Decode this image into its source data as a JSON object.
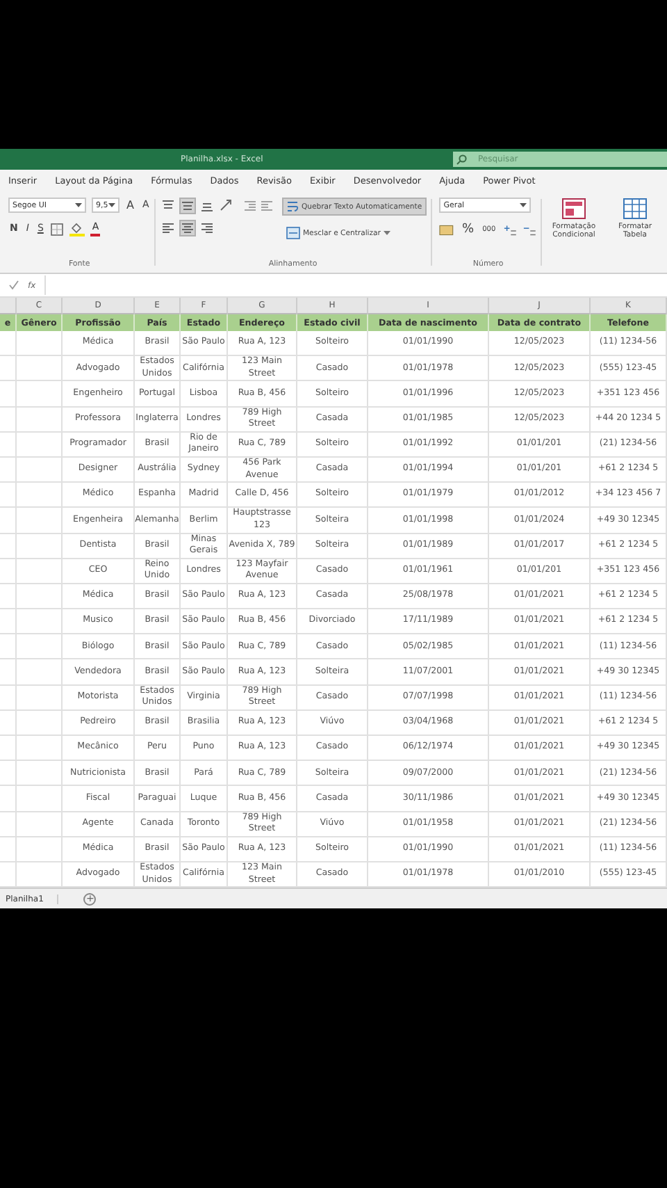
{
  "window": {
    "title": "Planilha.xlsx - Excel",
    "search": {
      "placeholder": "Pesquisar"
    }
  },
  "ribbon_tabs": [
    "Inserir",
    "Layout da Página",
    "Fórmulas",
    "Dados",
    "Revisão",
    "Exibir",
    "Desenvolvedor",
    "Ajuda",
    "Power Pivot"
  ],
  "font_group": {
    "label": "Fonte",
    "font": "Segoe UI",
    "size": "9,5",
    "grow": "A",
    "shrink": "A",
    "bold": "N",
    "italic": "I",
    "underline": "S",
    "color_letter": "A"
  },
  "alignment_group": {
    "label": "Alinhamento",
    "buttons": [
      {
        "kind": "top",
        "on": false
      },
      {
        "kind": "middle",
        "on": true
      },
      {
        "kind": "bottom",
        "on": false
      },
      {
        "kind": "left",
        "on": false
      },
      {
        "kind": "center",
        "on": true
      },
      {
        "kind": "right",
        "on": false
      }
    ],
    "wrap": {
      "label": "Quebrar Texto Automaticamente",
      "on": true
    },
    "merge": {
      "label": "Mesclar e Centralizar",
      "on": false
    }
  },
  "number_group": {
    "label": "Número",
    "format": "Geral",
    "percent": "%",
    "thousands": "000"
  },
  "styles_group": [
    {
      "label": "Formatação Condicional"
    },
    {
      "label": "Formatar Tabela"
    }
  ],
  "formula_bar": {
    "fx": "fx"
  },
  "column_letters": [
    "C",
    "D",
    "E",
    "F",
    "G",
    "H",
    "I",
    "J",
    "K"
  ],
  "header_row": [
    "e",
    "Gênero",
    "Profissão",
    "País",
    "Estado",
    "Endereço",
    "Estado civil",
    "Data de nascimento",
    "Data de contrato",
    "Telefone"
  ],
  "rows": [
    {
      "profissao": "Médica",
      "pais": "Brasil",
      "estado": "São Paulo",
      "endereco": "Rua A, 123",
      "estado_civil": "Solteiro",
      "nascimento": "01/01/1990",
      "contrato": "12/05/2023",
      "telefone": "(11) 1234-56"
    },
    {
      "profissao": "Advogado",
      "pais": "Estados Unidos",
      "estado": "Califórnia",
      "endereco": "123 Main Street",
      "estado_civil": "Casado",
      "nascimento": "01/01/1978",
      "contrato": "12/05/2023",
      "telefone": "(555) 123-45"
    },
    {
      "profissao": "Engenheiro",
      "pais": "Portugal",
      "estado": "Lisboa",
      "endereco": "Rua B, 456",
      "estado_civil": "Solteiro",
      "nascimento": "01/01/1996",
      "contrato": "12/05/2023",
      "telefone": "+351 123 456"
    },
    {
      "profissao": "Professora",
      "pais": "Inglaterra",
      "estado": "Londres",
      "endereco": "789 High Street",
      "estado_civil": "Casada",
      "nascimento": "01/01/1985",
      "contrato": "12/05/2023",
      "telefone": "+44 20 1234 5"
    },
    {
      "profissao": "Programador",
      "pais": "Brasil",
      "estado": "Rio de Janeiro",
      "endereco": "Rua C, 789",
      "estado_civil": "Solteiro",
      "nascimento": "01/01/1992",
      "contrato": "01/01/201",
      "telefone": "(21) 1234-56"
    },
    {
      "profissao": "Designer",
      "pais": "Austrália",
      "estado": "Sydney",
      "endereco": "456 Park Avenue",
      "estado_civil": "Casada",
      "nascimento": "01/01/1994",
      "contrato": "01/01/201",
      "telefone": "+61 2 1234 5"
    },
    {
      "profissao": "Médico",
      "pais": "Espanha",
      "estado": "Madrid",
      "endereco": "Calle D, 456",
      "estado_civil": "Solteiro",
      "nascimento": "01/01/1979",
      "contrato": "01/01/2012",
      "telefone": "+34 123 456 7"
    },
    {
      "profissao": "Engenheira",
      "pais": "Alemanha",
      "estado": "Berlim",
      "endereco": "Hauptstrasse 123",
      "estado_civil": "Solteira",
      "nascimento": "01/01/1998",
      "contrato": "01/01/2024",
      "telefone": "+49 30 12345"
    },
    {
      "profissao": "Dentista",
      "pais": "Brasil",
      "estado": "Minas Gerais",
      "endereco": "Avenida X, 789",
      "estado_civil": "Solteira",
      "nascimento": "01/01/1989",
      "contrato": "01/01/2017",
      "telefone": "+61 2 1234 5"
    },
    {
      "profissao": "CEO",
      "pais": "Reino Unido",
      "estado": "Londres",
      "endereco": "123 Mayfair Avenue",
      "estado_civil": "Casado",
      "nascimento": "01/01/1961",
      "contrato": "01/01/201",
      "telefone": "+351 123 456"
    },
    {
      "profissao": "Médica",
      "pais": "Brasil",
      "estado": "São Paulo",
      "endereco": "Rua A, 123",
      "estado_civil": "Casada",
      "nascimento": "25/08/1978",
      "contrato": "01/01/2021",
      "telefone": "+61 2 1234 5"
    },
    {
      "profissao": "Musico",
      "pais": "Brasil",
      "estado": "São Paulo",
      "endereco": "Rua B, 456",
      "estado_civil": "Divorciado",
      "nascimento": "17/11/1989",
      "contrato": "01/01/2021",
      "telefone": "+61 2 1234 5"
    },
    {
      "profissao": "Biólogo",
      "pais": "Brasil",
      "estado": "São Paulo",
      "endereco": "Rua C, 789",
      "estado_civil": "Casado",
      "nascimento": "05/02/1985",
      "contrato": "01/01/2021",
      "telefone": "(11) 1234-56"
    },
    {
      "profissao": "Vendedora",
      "pais": "Brasil",
      "estado": "São Paulo",
      "endereco": "Rua A, 123",
      "estado_civil": "Solteira",
      "nascimento": "11/07/2001",
      "contrato": "01/01/2021",
      "telefone": "+49 30 12345"
    },
    {
      "profissao": "Motorista",
      "pais": "Estados Unidos",
      "estado": "Virginia",
      "endereco": "789 High Street",
      "estado_civil": "Casado",
      "nascimento": "07/07/1998",
      "contrato": "01/01/2021",
      "telefone": "(11) 1234-56"
    },
    {
      "profissao": "Pedreiro",
      "pais": "Brasil",
      "estado": "Brasilia",
      "endereco": "Rua A, 123",
      "estado_civil": "Viúvo",
      "nascimento": "03/04/1968",
      "contrato": "01/01/2021",
      "telefone": "+61 2 1234 5"
    },
    {
      "profissao": "Mecânico",
      "pais": "Peru",
      "estado": "Puno",
      "endereco": "Rua A, 123",
      "estado_civil": "Casado",
      "nascimento": "06/12/1974",
      "contrato": "01/01/2021",
      "telefone": "+49 30 12345"
    },
    {
      "profissao": "Nutricionista",
      "pais": "Brasil",
      "estado": "Pará",
      "endereco": "Rua C, 789",
      "estado_civil": "Solteira",
      "nascimento": "09/07/2000",
      "contrato": "01/01/2021",
      "telefone": "(21) 1234-56"
    },
    {
      "profissao": "Fiscal",
      "pais": "Paraguai",
      "estado": "Luque",
      "endereco": "Rua B, 456",
      "estado_civil": "Casada",
      "nascimento": "30/11/1986",
      "contrato": "01/01/2021",
      "telefone": "+49 30 12345"
    },
    {
      "profissao": "Agente",
      "pais": "Canada",
      "estado": "Toronto",
      "endereco": "789 High Street",
      "estado_civil": "Viúvo",
      "nascimento": "01/01/1958",
      "contrato": "01/01/2021",
      "telefone": "(21) 1234-56"
    },
    {
      "profissao": "Médica",
      "pais": "Brasil",
      "estado": "São Paulo",
      "endereco": "Rua A, 123",
      "estado_civil": "Solteiro",
      "nascimento": "01/01/1990",
      "contrato": "01/01/2021",
      "telefone": "(11) 1234-56"
    },
    {
      "profissao": "Advogado",
      "pais": "Estados Unidos",
      "estado": "Califórnia",
      "endereco": "123 Main Street",
      "estado_civil": "Casado",
      "nascimento": "01/01/1978",
      "contrato": "01/01/2010",
      "telefone": "(555) 123-45"
    }
  ],
  "sheet_tabs": [
    {
      "label": "Planilha1",
      "selected": true
    }
  ],
  "add_sheet": "+"
}
